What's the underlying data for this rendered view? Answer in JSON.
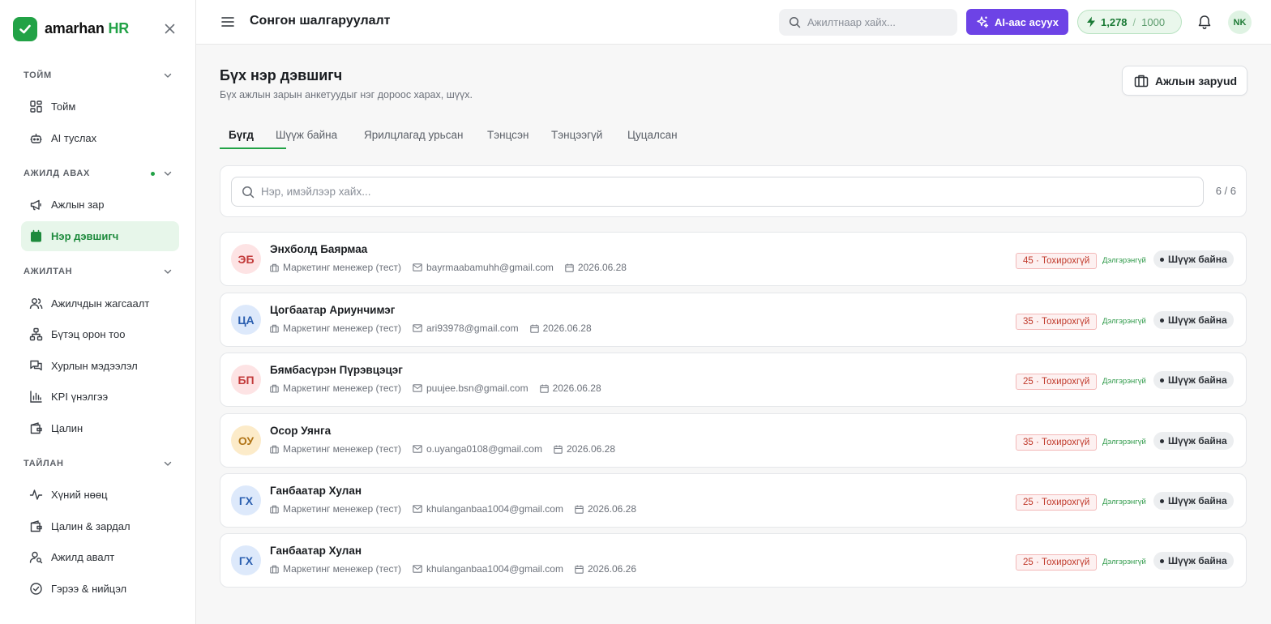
{
  "brand": {
    "name": "amarhan",
    "suffix": "HR",
    "accent": "#22a246"
  },
  "sidebar": {
    "sections": [
      {
        "label": "ТОЙМ",
        "items": [
          {
            "label": "Тойм",
            "icon": "dashboard-icon"
          },
          {
            "label": "AI туслах",
            "icon": "robot-icon"
          }
        ]
      },
      {
        "label": "АЖИЛД АВАХ",
        "items": [
          {
            "label": "Ажлын зар",
            "icon": "megaphone-icon"
          },
          {
            "label": "Нэр дэвшигч",
            "icon": "calendar-icon",
            "active": true
          }
        ]
      },
      {
        "label": "АЖИЛТАН",
        "items": [
          {
            "label": "Ажилчдын жагсаалт",
            "icon": "users-icon"
          },
          {
            "label": "Бүтэц орон тоо",
            "icon": "org-chart-icon"
          },
          {
            "label": "Хурлын мэдээлэл",
            "icon": "chat-icon"
          },
          {
            "label": "KPI үнэлгээ",
            "icon": "bar-chart-icon"
          },
          {
            "label": "Цалин",
            "icon": "wallet-icon"
          }
        ]
      },
      {
        "label": "ТАЙЛАН",
        "items": [
          {
            "label": "Хүний нөөц",
            "icon": "activity-icon"
          },
          {
            "label": "Цалин & зардал",
            "icon": "wallet-icon"
          },
          {
            "label": "Ажилд авалт",
            "icon": "user-search-icon"
          },
          {
            "label": "Гэрээ & нийцэл",
            "icon": "check-circle-icon"
          }
        ]
      }
    ]
  },
  "header": {
    "title": "Сонгон шалгаруулалт",
    "search_placeholder": "Ажилтнаар хайх...",
    "ai_button": "AI-аас асуух",
    "credits_used": "1,278",
    "credits_sep": "/",
    "credits_total": "1000",
    "avatar": "NK"
  },
  "main": {
    "heading": "Бүх нэр дэвшигч",
    "subheading": "Бүх ажлын зарын анкетуудыг нэг дороос харах, шүүх.",
    "jobs_button": "Ажлын заруud",
    "tabs": [
      "Бүгд",
      "Шүүж байна",
      "Ярилцлагад урьсан",
      "Тэнцсэн",
      "Тэнцээгүй",
      "Цуцалсан"
    ],
    "search_placeholder": "Нэр, имэйлээр хайх...",
    "count": "6 / 6"
  },
  "candidates": [
    {
      "initials": "ЭБ",
      "name": "Энхболд Баярмаа",
      "job": "Маркетинг менежер (тест)",
      "email": "bayrmaabamuhh@gmail.com",
      "date": "2026.06.28",
      "score": "45 · Тохирохгүй",
      "detail": "Дэлгэрэнгүй",
      "status": "Шүүж байна",
      "color": "red"
    },
    {
      "initials": "ЦА",
      "name": "Цогбаатар Ариунчимэг",
      "job": "Маркетинг менежер (тест)",
      "email": "ari93978@gmail.com",
      "date": "2026.06.28",
      "score": "35 · Тохирохгүй",
      "detail": "Дэлгэрэнгүй",
      "status": "Шүүж байна",
      "color": "blue"
    },
    {
      "initials": "БП",
      "name": "Бямбасүрэн Пүрэвцэцэг",
      "job": "Маркетинг менежер (тест)",
      "email": "puujee.bsn@gmail.com",
      "date": "2026.06.28",
      "score": "25 · Тохирохгүй",
      "detail": "Дэлгэрэнгүй",
      "status": "Шүүж байна",
      "color": "red"
    },
    {
      "initials": "ОУ",
      "name": "Осор Уянга",
      "job": "Маркетинг менежер (тест)",
      "email": "o.uyanga0108@gmail.com",
      "date": "2026.06.28",
      "score": "35 · Тохирохгүй",
      "detail": "Дэлгэрэнгүй",
      "status": "Шүүж байна",
      "color": "orange"
    },
    {
      "initials": "ГХ",
      "name": "Ганбаатар Хулан",
      "job": "Маркетинг менежер (тест)",
      "email": "khulanganbaa1004@gmail.com",
      "date": "2026.06.28",
      "score": "25 · Тохирохгүй",
      "detail": "Дэлгэрэнгүй",
      "status": "Шүүж байна",
      "color": "blue"
    },
    {
      "initials": "ГХ",
      "name": "Ганбаатар Хулан",
      "job": "Маркетинг менежер (тест)",
      "email": "khulanganbaa1004@gmail.com",
      "date": "2026.06.26",
      "score": "25 · Тохирохгүй",
      "detail": "Дэлгэрэнгүй",
      "status": "Шүүж байна",
      "color": "blue"
    }
  ]
}
